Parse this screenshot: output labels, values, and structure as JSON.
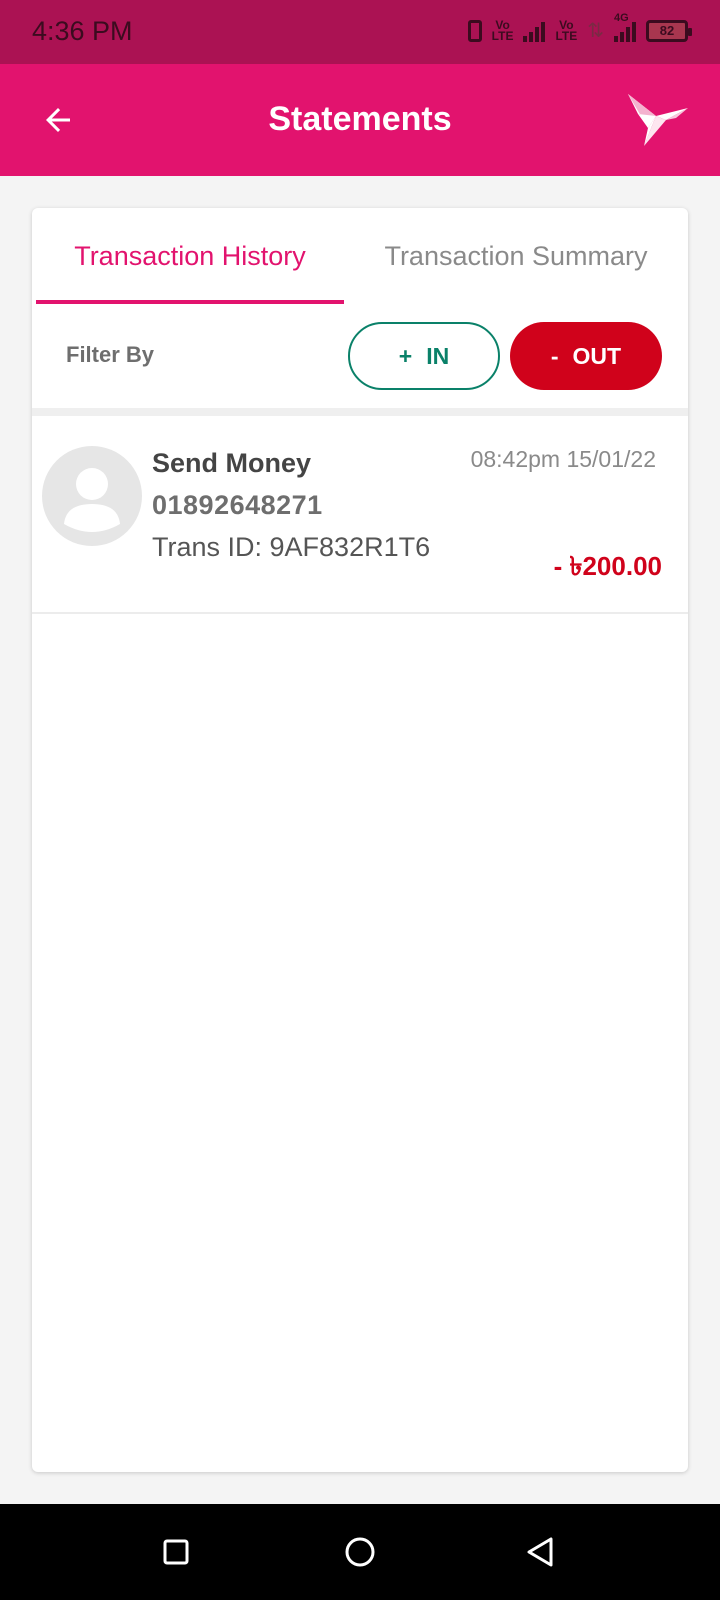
{
  "status_bar": {
    "time": "4:36 PM",
    "network_1": "Vo LTE",
    "network_2": "Vo LTE",
    "network_type": "4G",
    "battery": "82"
  },
  "app_bar": {
    "title": "Statements",
    "back_icon": "arrow-left-icon",
    "logo_icon": "bkash-bird-logo"
  },
  "tabs": [
    {
      "label": "Transaction History",
      "active": true
    },
    {
      "label": "Transaction Summary",
      "active": false
    }
  ],
  "filter": {
    "label": "Filter By",
    "in_sign": "+",
    "in_label": "IN",
    "out_sign": "-",
    "out_label": "OUT"
  },
  "transactions": [
    {
      "type": "Send Money",
      "number": "01892648271",
      "trans_id": "Trans ID: 9AF832R1T6",
      "time": "08:42pm 15/01/22",
      "amount": "- ৳200.00"
    }
  ],
  "colors": {
    "brand": "#e2136e",
    "status_bar": "#ab1253",
    "in_green": "#0a8169",
    "out_red": "#d0021b"
  }
}
